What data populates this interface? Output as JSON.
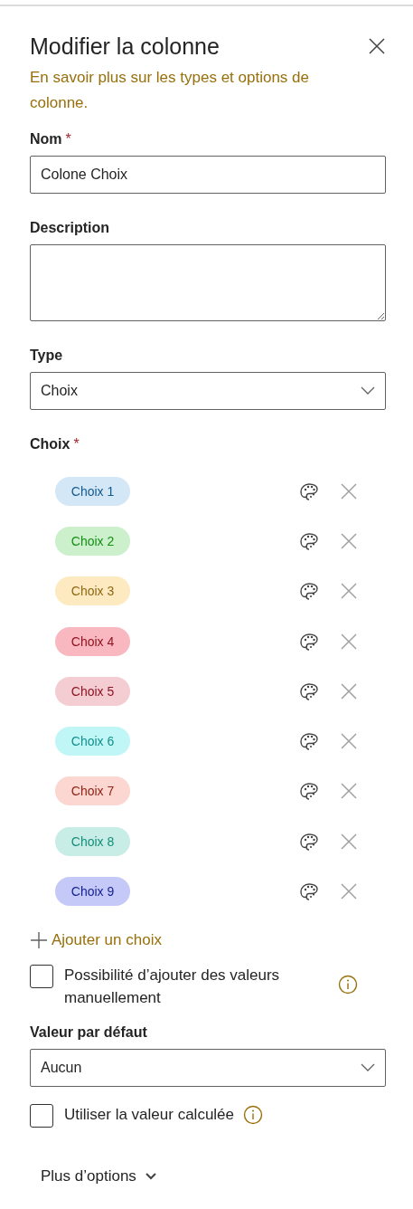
{
  "panel": {
    "title": "Modifier la colonne",
    "link": "En savoir plus sur les types et options de colonne."
  },
  "fields": [
    {
      "kind": "text",
      "label": "Nom",
      "required_mark": "*",
      "value": "Colone Choix"
    },
    {
      "kind": "textarea",
      "label": "Description"
    },
    {
      "kind": "select",
      "label": "Type",
      "value": "Choix"
    }
  ],
  "choices_section": {
    "label": "Choix",
    "required_mark": "*"
  },
  "choices": [
    {
      "label": "Choix 1",
      "color": "#d4e7f6"
    },
    {
      "label": "Choix 2",
      "color": "#ccf0cc"
    },
    {
      "label": "Choix 3",
      "color": "#fdeac1"
    },
    {
      "label": "Choix 4",
      "color": "#f9b8c0"
    },
    {
      "label": "Choix 5",
      "color": "#f3cdd2"
    },
    {
      "label": "Choix 6",
      "color": "#c0f7f6"
    },
    {
      "label": "Choix 7",
      "color": "#fcd6d0"
    },
    {
      "label": "Choix 8",
      "color": "#c8ece6"
    },
    {
      "label": "Choix 9",
      "color": "#c5c9f7"
    }
  ],
  "add_choice": "Ajouter un choix",
  "manual_values": {
    "label": "Possibilité d’ajouter des valeurs manuellement",
    "checked": false
  },
  "default_value": {
    "label": "Valeur par défaut",
    "value": "Aucun"
  },
  "calculated_value": {
    "label": "Utiliser la valeur calculée",
    "checked": false
  },
  "more_options": "Plus d’options"
}
